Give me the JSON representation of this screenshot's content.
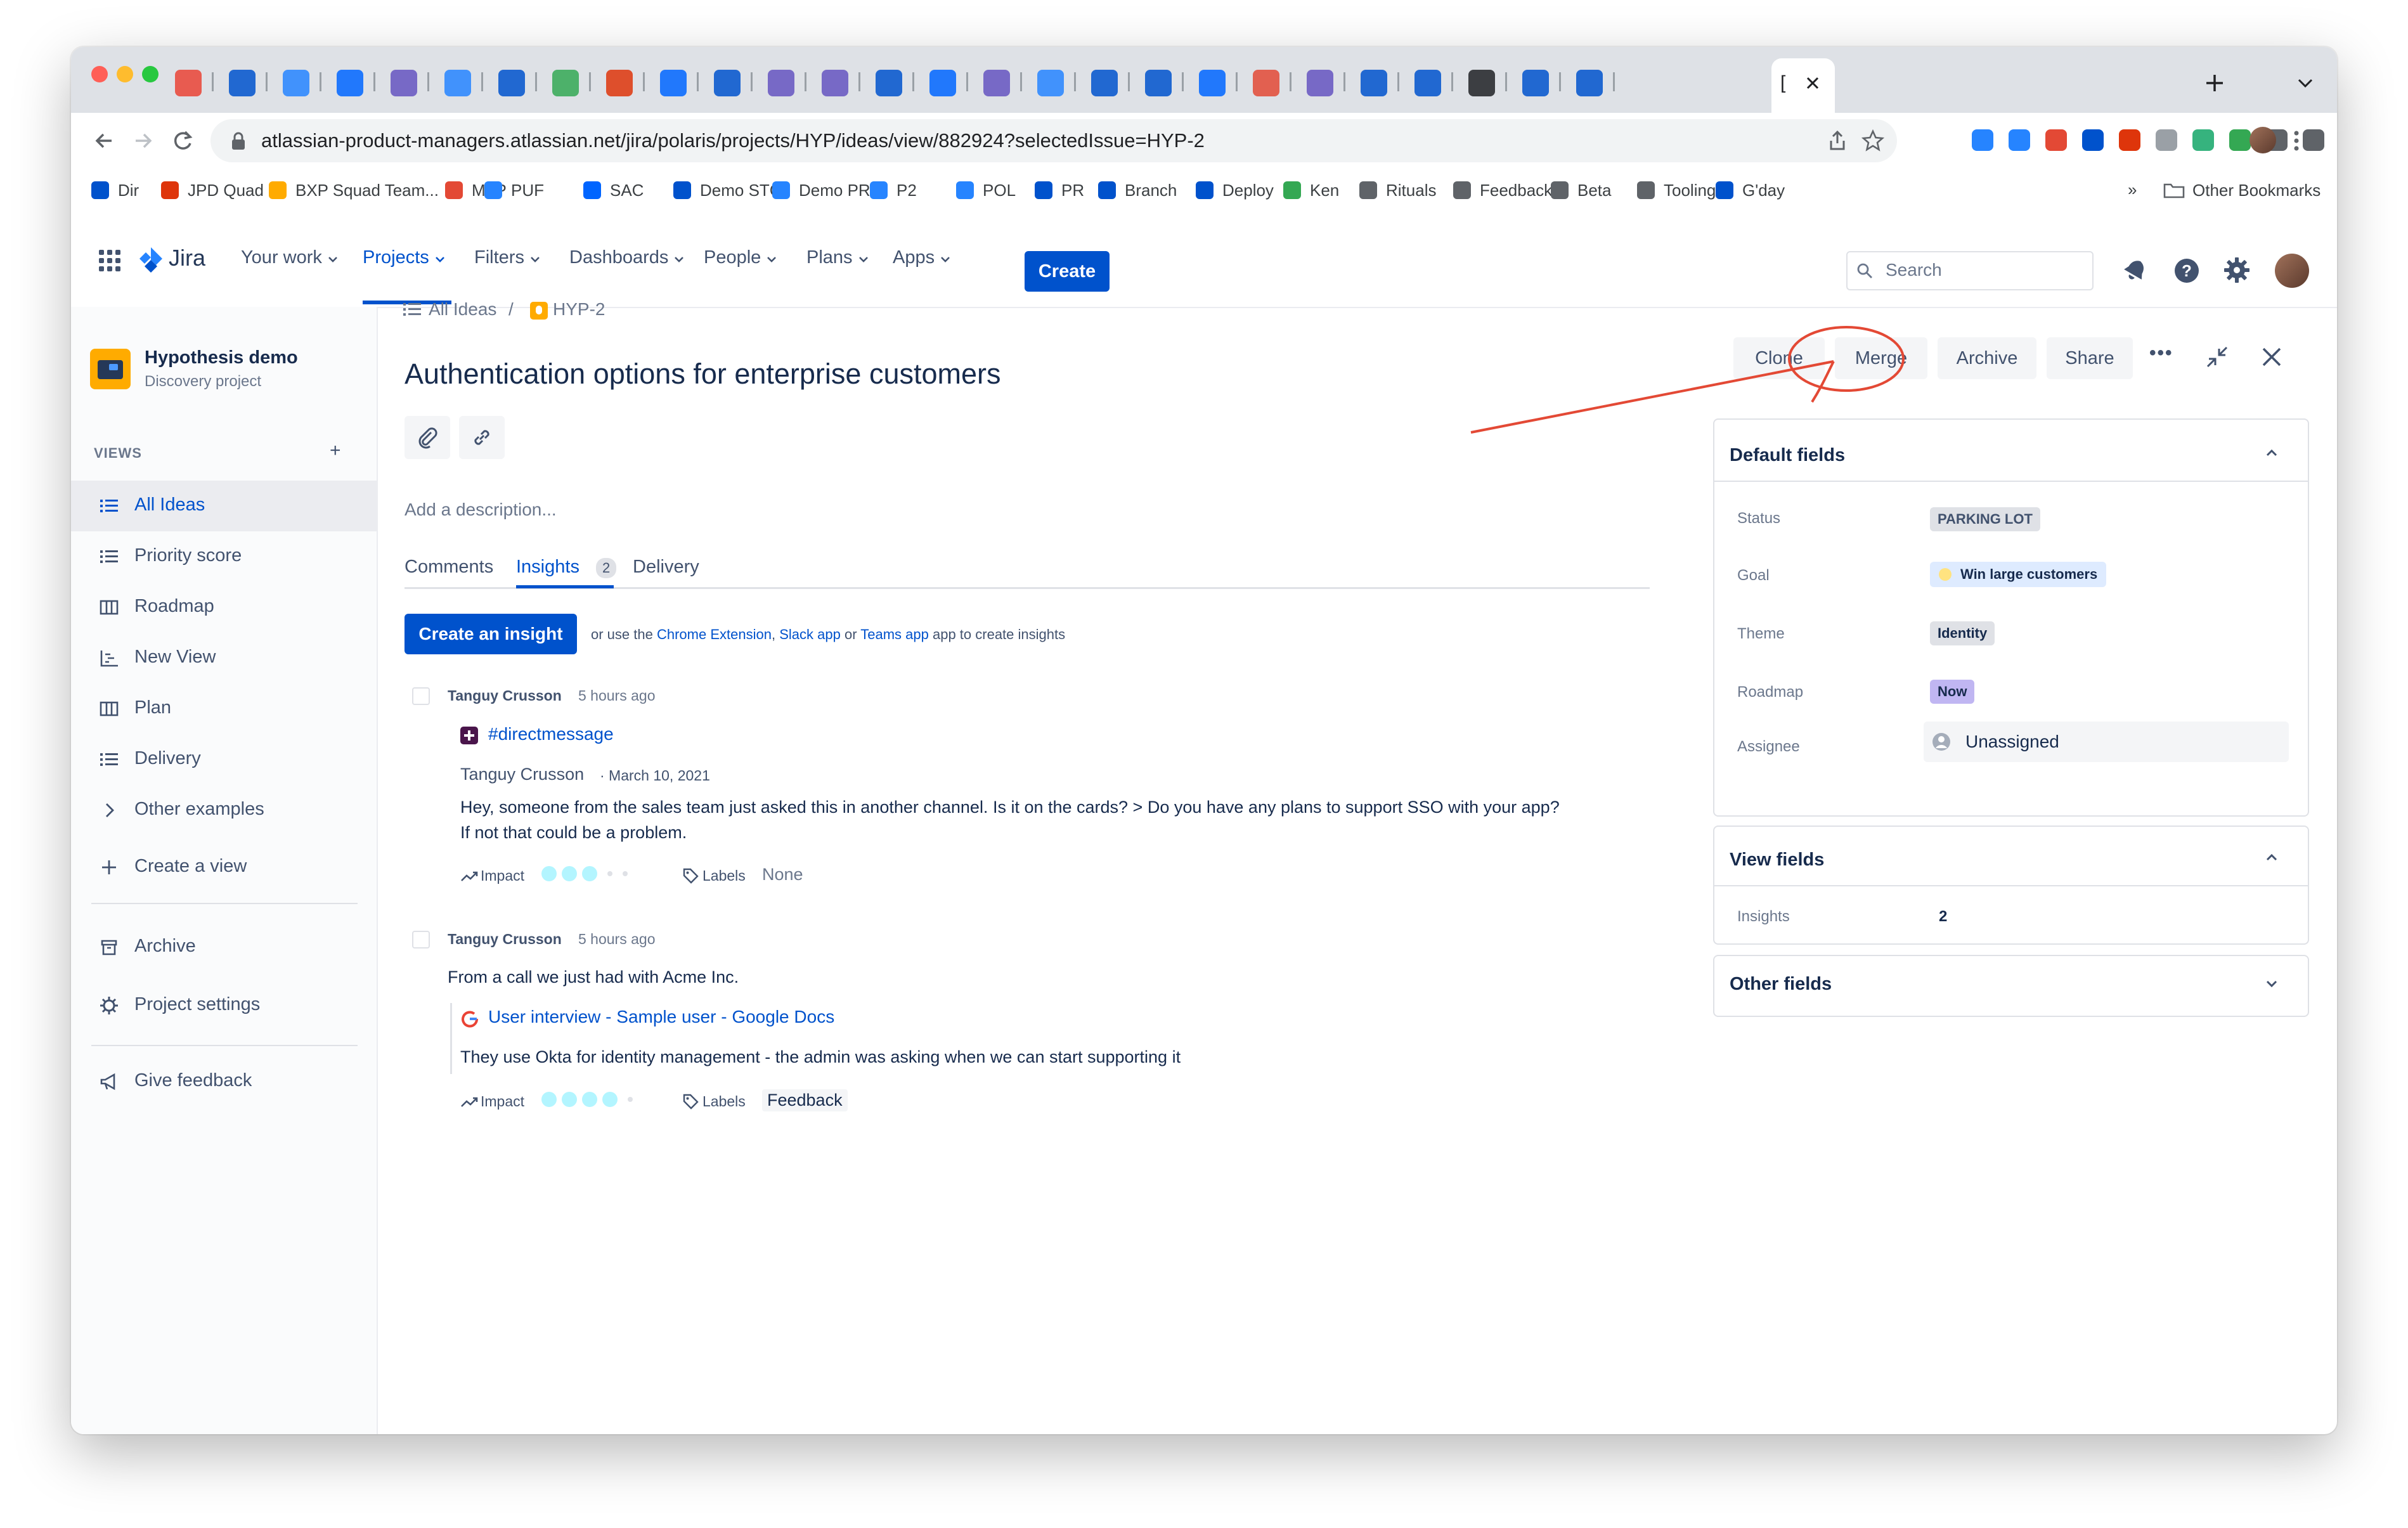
{
  "browser": {
    "url": "atlassian-product-managers.atlassian.net/jira/polaris/projects/HYP/ideas/view/882924?selectedIssue=HYP-2",
    "bookmarks": [
      "Dir",
      "JPD Quad",
      "BXP Squad Team...",
      "MTP",
      "PUF",
      "SAC",
      "Demo STG",
      "Demo PRD",
      "P2",
      "POL",
      "PR",
      "Branch",
      "Deploy",
      "Ken",
      "Rituals",
      "Feedback",
      "Beta",
      "Tooling",
      "G'day"
    ],
    "more_bookmarks": "»",
    "other_bookmarks": "Other Bookmarks",
    "active_tab_title": "[",
    "colors": {
      "tab_bar": "#dee1e6",
      "traffic_close": "#ff5f57",
      "traffic_min": "#febc2e",
      "traffic_max": "#28c840"
    }
  },
  "topnav": {
    "logo": "Jira",
    "items": [
      "Your work",
      "Projects",
      "Filters",
      "Dashboards",
      "People",
      "Plans",
      "Apps"
    ],
    "active_item": "Projects",
    "create_label": "Create",
    "search_placeholder": "Search",
    "colors": {
      "primary": "#0052CC",
      "active": "#0052CC"
    }
  },
  "sidebar": {
    "project_name": "Hypothesis demo",
    "project_type": "Discovery project",
    "views_header": "VIEWS",
    "add_icon": "+",
    "items": [
      {
        "label": "All Ideas",
        "icon": "list-icon",
        "active": true
      },
      {
        "label": "Priority score",
        "icon": "list-icon"
      },
      {
        "label": "Roadmap",
        "icon": "board-icon"
      },
      {
        "label": "New View",
        "icon": "timeline-icon"
      },
      {
        "label": "Plan",
        "icon": "board-icon"
      },
      {
        "label": "Delivery",
        "icon": "list-icon"
      },
      {
        "label": "Other examples",
        "icon": "chevron-right-icon"
      },
      {
        "label": "Create a view",
        "icon": "plus-icon"
      }
    ],
    "archive": "Archive",
    "settings": "Project settings",
    "feedback": "Give feedback"
  },
  "breadcrumb": {
    "all_ideas": "All Ideas",
    "sep": "/",
    "key": "HYP-2"
  },
  "actions": {
    "clone": "Clone",
    "merge": "Merge",
    "archive": "Archive",
    "share": "Share",
    "more": "•••"
  },
  "issue": {
    "title": "Authentication options for enterprise customers",
    "description_placeholder": "Add a description...",
    "tabs": {
      "comments": "Comments",
      "insights": "Insights",
      "insights_count": "2",
      "delivery": "Delivery"
    },
    "create_insight": "Create an insight",
    "helper": {
      "prefix": "or use the",
      "chrome": "Chrome Extension",
      "comma": ",",
      "slack": "Slack app",
      "or": "or",
      "teams": "Teams app",
      "suffix": "app to create insights"
    }
  },
  "insights": [
    {
      "author": "Tanguy Crusson",
      "time": "5 hours ago",
      "source": "#directmessage",
      "quote_author": "Tanguy Crusson",
      "quote_date": "· March 10, 2021",
      "quote_line1": "Hey, someone from the sales team just asked this in another channel. Is it on the cards? >  Do you have any plans to support SSO with your app?",
      "quote_line2": "If not that could be a problem.",
      "impact_label": "Impact",
      "impact_level": 3,
      "labels_label": "Labels",
      "labels_value": "None"
    },
    {
      "author": "Tanguy Crusson",
      "time": "5 hours ago",
      "summary": "From a call we just had with Acme Inc.",
      "link": "User interview - Sample user - Google Docs",
      "quote": "They use Okta for identity management - the admin was asking when we can start supporting it",
      "impact_label": "Impact",
      "impact_level": 4,
      "labels_label": "Labels",
      "labels_value": "Feedback"
    }
  ],
  "fields": {
    "default_header": "Default fields",
    "status_label": "Status",
    "status_value": "PARKING LOT",
    "goal_label": "Goal",
    "goal_value": "Win large customers",
    "theme_label": "Theme",
    "theme_value": "Identity",
    "roadmap_label": "Roadmap",
    "roadmap_value": "Now",
    "assignee_label": "Assignee",
    "assignee_value": "Unassigned",
    "view_header": "View fields",
    "insights_label": "Insights",
    "insights_value": "2",
    "other_header": "Other fields"
  }
}
